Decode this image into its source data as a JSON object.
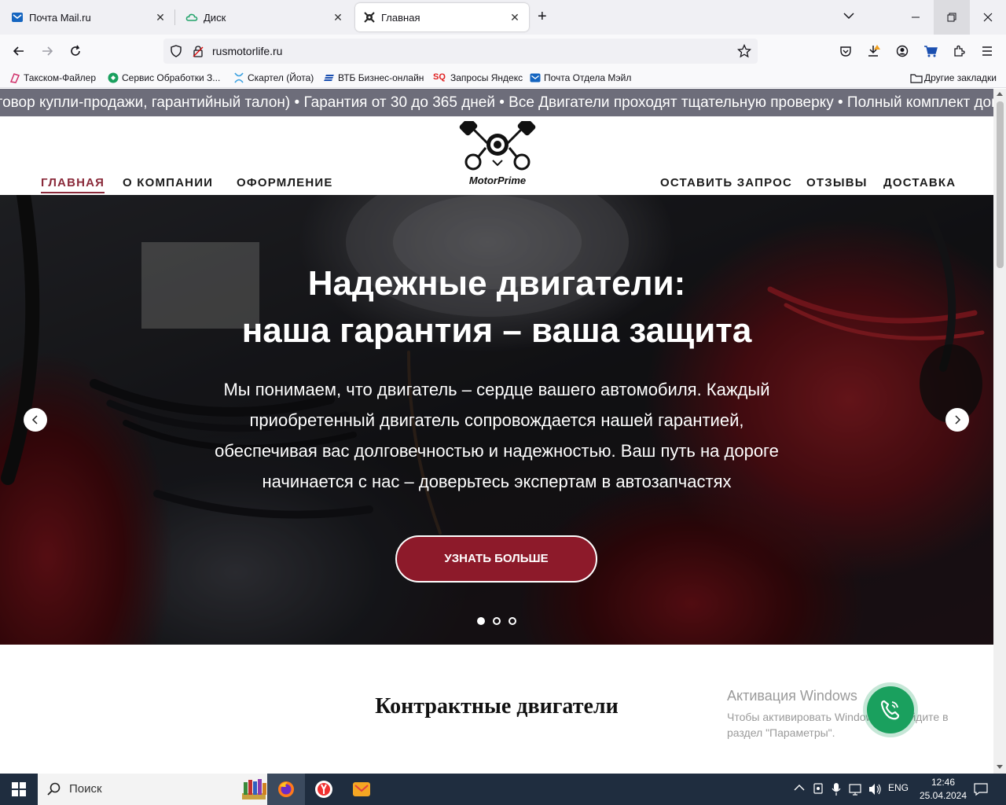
{
  "browser": {
    "tabs": [
      {
        "label": "Почта Mail.ru",
        "icon": "mail-icon",
        "active": false
      },
      {
        "label": "Диск",
        "icon": "cloud-icon",
        "active": false
      },
      {
        "label": "Главная",
        "icon": "engine-logo-icon",
        "active": true
      }
    ],
    "new_tab_symbol": "+",
    "url": "rusmotorlife.ru",
    "bookmarks": [
      "Такском-Файлер",
      "Сервис Обработки З...",
      "Скартел (Йота)",
      "ВТБ Бизнес-онлайн",
      "Запросы Яндекс",
      "Почта Отдела Мэйл"
    ],
    "other_bookmarks": "Другие закладки",
    "colors": {
      "tabstrip": "#f0f0f4",
      "toolbar": "#f9f9fb"
    }
  },
  "site": {
    "ticker": "оговор купли-продажи, гарантийный талон)  •  Гарантия от 30 до 365 дней  •  Все Двигатели проходят тщательную проверку  •  Полный комплект докуме",
    "nav_left": [
      "ГЛАВНАЯ",
      "О КОМПАНИИ",
      "ОФОРМЛЕНИЕ"
    ],
    "nav_right": [
      "ОСТАВИТЬ ЗАПРОС",
      "ОТЗЫВЫ",
      "ДОСТАВКА"
    ],
    "logo_text": "MotorPrime",
    "hero": {
      "title_line1": "Надежные двигатели:",
      "title_line2": "наша гарантия – ваша защита",
      "text": "Мы понимаем, что двигатель – сердце вашего автомобиля. Каждый приобретенный двигатель сопровождается нашей гарантией, обеспечивая вас долговечностью и надежностью. Ваш путь на дороге начинается с нас – доверьтесь экспертам в автозапчастях",
      "button": "УЗНАТЬ БОЛЬШЕ",
      "slides_total": 3,
      "active_slide": 1
    },
    "section_title": "Контрактные двигатели",
    "colors": {
      "accent": "#8d1a2a",
      "ticker_bg": "#6d6d7a",
      "call_button": "#1aa05e"
    }
  },
  "windows_activation": {
    "title": "Активация Windows",
    "text": "Чтобы активировать Windows, перейдите в раздел \"Параметры\"."
  },
  "taskbar": {
    "search_placeholder": "Поиск",
    "language": "ENG",
    "time": "12:46",
    "date": "25.04.2024"
  }
}
